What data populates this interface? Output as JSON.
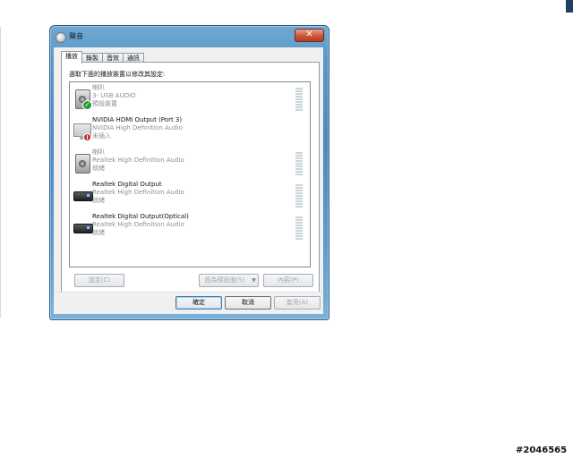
{
  "window": {
    "title": "聲音",
    "close_glyph": "✕",
    "sound_icon": "sound-icon"
  },
  "tabs": [
    {
      "label": "播放",
      "active": true
    },
    {
      "label": "錄製",
      "active": false
    },
    {
      "label": "音效",
      "active": false
    },
    {
      "label": "通訊",
      "active": false
    }
  ],
  "instruction": "選取下面的播放裝置以修改其設定:",
  "devices": [
    {
      "name": "喇叭",
      "line2": "3- USB AUDIO",
      "status": "預設裝置",
      "icon": "speaker-icon",
      "badge": "check",
      "check_glyph": "✓",
      "meter": true,
      "disabled": true
    },
    {
      "name": "NVIDIA HDMI Output (Port 3)",
      "line2": "NVIDIA High Definition Audio",
      "status": "未插入",
      "icon": "monitor-icon",
      "badge": "unplugged",
      "meter": false,
      "disabled": false
    },
    {
      "name": "喇叭",
      "line2": "Realtek High Definition Audio",
      "status": "就緒",
      "icon": "speaker-icon",
      "badge": "",
      "meter": true,
      "disabled": true
    },
    {
      "name": "Realtek Digital Output",
      "line2": "Realtek High Definition Audio",
      "status": "就緒",
      "icon": "digital-output-icon",
      "badge": "",
      "meter": true,
      "disabled": false
    },
    {
      "name": "Realtek Digital Output(Optical)",
      "line2": "Realtek High Definition Audio",
      "status": "就緒",
      "icon": "digital-output-icon",
      "badge": "",
      "meter": true,
      "disabled": false
    }
  ],
  "buttons": {
    "configure": "設定(C)",
    "set_default": "設為預設值(S)",
    "set_default_arrow": "▼",
    "properties": "內容(P)",
    "ok": "確定",
    "cancel": "取消",
    "apply": "套用(A)"
  },
  "watermark": "#2046565"
}
